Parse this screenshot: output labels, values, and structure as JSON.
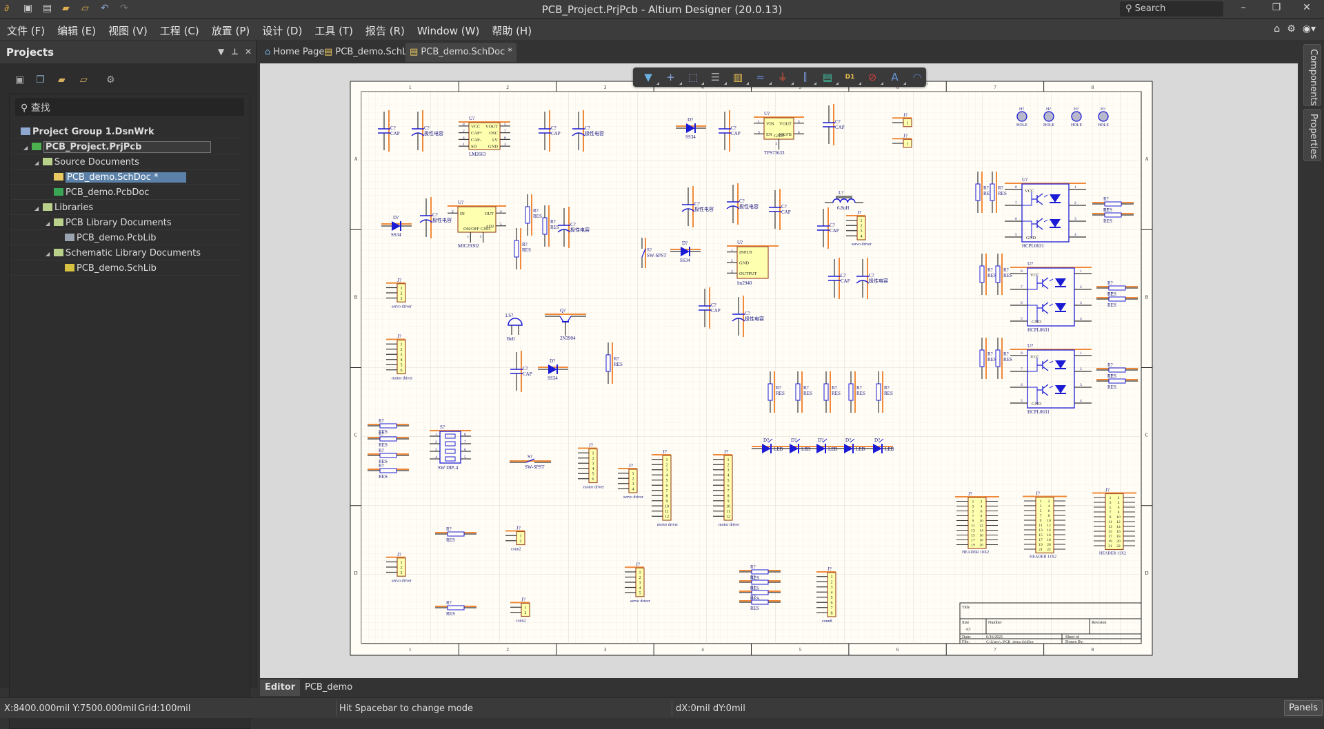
{
  "titlebar": {
    "title": "PCB_Project.PrjPcb - Altium Designer (20.0.13)",
    "search_placeholder": "Search"
  },
  "menu": [
    "文件 (F)",
    "编辑 (E)",
    "视图 (V)",
    "工程 (C)",
    "放置 (P)",
    "设计 (D)",
    "工具 (T)",
    "报告 (R)",
    "Window (W)",
    "帮助 (H)"
  ],
  "projects_panel": {
    "title": "Projects",
    "search_placeholder": "查找",
    "tree": [
      {
        "label": "Project Group 1.DsnWrk",
        "bold": true,
        "icon": "workspace-icon"
      },
      {
        "label": "PCB_Project.PrjPcb",
        "bold": true,
        "icon": "pcb-project-icon",
        "selected_outline": true
      },
      {
        "label": "Source Documents",
        "icon": "folder-icon"
      },
      {
        "label": "PCB_demo.SchDoc *",
        "icon": "schdoc-icon",
        "selected": true
      },
      {
        "label": "PCB_demo.PcbDoc",
        "icon": "pcbdoc-icon"
      },
      {
        "label": "Libraries",
        "icon": "folder-icon"
      },
      {
        "label": "PCB Library Documents",
        "icon": "folder-icon"
      },
      {
        "label": "PCB_demo.PcbLib",
        "icon": "pcblib-icon"
      },
      {
        "label": "Schematic Library Documents",
        "icon": "folder-icon"
      },
      {
        "label": "PCB_demo.SchLib",
        "icon": "schlib-icon"
      }
    ]
  },
  "doc_tabs": [
    {
      "label": "Home Page",
      "icon": "home-icon"
    },
    {
      "label": "PCB_demo.SchLib",
      "icon": "schlib-icon"
    },
    {
      "label": "PCB_demo.SchDoc *",
      "icon": "schdoc-icon",
      "active": true
    }
  ],
  "schematic_toolbar": [
    "filter",
    "place-wire",
    "select-area",
    "align",
    "place-part",
    "place-bus",
    "place-ground",
    "place-port",
    "place-sheet-symbol",
    "place-net-label",
    "no-erc",
    "place-text",
    "place-arc"
  ],
  "sheet": {
    "columns": [
      "1",
      "2",
      "3",
      "4",
      "5",
      "6",
      "7",
      "8"
    ],
    "rows": [
      "A",
      "B",
      "C",
      "D"
    ],
    "title_block": {
      "title_label": "Title",
      "size_label": "Size",
      "size": "A3",
      "number_label": "Number",
      "revision_label": "Revision",
      "date_label": "Date:",
      "date": "6/16/2021",
      "sheet_label": "Sheet   of",
      "file_label": "File:",
      "file": "C:\\Users\\..\\PCB_demo.SchDoc",
      "drawn_by_label": "Drawn By:"
    }
  },
  "components": [
    {
      "type": "cap",
      "des": "C?",
      "value": "CAP"
    },
    {
      "type": "pcap",
      "des": "C?",
      "value": "极性电容"
    },
    {
      "type": "ic",
      "des": "U?",
      "value": "LM2663",
      "left": [
        "VCC",
        "CAP+",
        "CAP-",
        "SD"
      ],
      "right": [
        "VOUT",
        "OSC",
        "LV",
        "GND"
      ],
      "lpins": [
        "8",
        "2",
        "4",
        "1"
      ],
      "rpins": [
        "5",
        "7",
        "6",
        "3"
      ]
    },
    {
      "type": "cap",
      "des": "C?",
      "value": "CAP"
    },
    {
      "type": "pcap",
      "des": "C?",
      "value": "极性电容"
    },
    {
      "type": "diode",
      "des": "D?",
      "value": "SS34"
    },
    {
      "type": "cap",
      "des": "C?",
      "value": "CAP"
    },
    {
      "type": "ic",
      "des": "U?",
      "value": "TPS73633",
      "left": [
        "VIN",
        "EN"
      ],
      "right": [
        "VOUT",
        "NR/FB"
      ],
      "lpins": [
        "1",
        "3"
      ],
      "rpins": [
        "5",
        "4"
      ],
      "bottom": "GND",
      "bpins": [
        "2"
      ]
    },
    {
      "type": "cap",
      "des": "C?",
      "value": "CAP"
    },
    {
      "type": "header",
      "des": "J?",
      "value": "",
      "pins": [
        "1"
      ]
    },
    {
      "type": "header",
      "des": "J?",
      "value": "",
      "pins": [
        "1"
      ]
    },
    {
      "type": "hole",
      "des": "H?",
      "value": "HOLE"
    },
    {
      "type": "hole",
      "des": "H?",
      "value": "HOLE"
    },
    {
      "type": "hole",
      "des": "H?",
      "value": "HOLE"
    },
    {
      "type": "hole",
      "des": "H?",
      "value": "HOLE"
    },
    {
      "type": "diode",
      "des": "D?",
      "value": "SS34"
    },
    {
      "type": "pcap",
      "des": "C?",
      "value": "极性电容"
    },
    {
      "type": "ic",
      "des": "U?",
      "value": "MIC29302",
      "left": [
        "IN"
      ],
      "right": [
        "OUT",
        "ADJ"
      ],
      "lpins": [
        "2"
      ],
      "rpins": [
        "4",
        "5"
      ],
      "bottom": "ON/OFF GND",
      "bpins": [
        "1",
        "3"
      ]
    },
    {
      "type": "res",
      "des": "R?",
      "value": "RES"
    },
    {
      "type": "res",
      "des": "R?",
      "value": "RES"
    },
    {
      "type": "res",
      "des": "R?",
      "value": "RES"
    },
    {
      "type": "pcap",
      "des": "C?",
      "value": "极性电容"
    },
    {
      "type": "pcap",
      "des": "C?",
      "value": "极性电容"
    },
    {
      "type": "pcap",
      "des": "C?",
      "value": "极性电容"
    },
    {
      "type": "cap",
      "des": "C?",
      "value": "CAP"
    },
    {
      "type": "inductor",
      "des": "L?",
      "value": "6.8uH"
    },
    {
      "type": "cap",
      "des": "C?",
      "value": "CAP"
    },
    {
      "type": "header",
      "des": "J?",
      "value": "servo driver",
      "pins": [
        "1",
        "2",
        "3",
        "4"
      ]
    },
    {
      "type": "switch",
      "des": "S?",
      "value": "SW-SPST"
    },
    {
      "type": "diode",
      "des": "D?",
      "value": "SS34"
    },
    {
      "type": "ic",
      "des": "U?",
      "value": "lm2940",
      "left": [
        "INPUT",
        "GND",
        "OUTPUT"
      ],
      "right": [],
      "lpins": [
        "1",
        "2",
        "3"
      ],
      "rpins": []
    },
    {
      "type": "cap",
      "des": "C?",
      "value": "CAP"
    },
    {
      "type": "pcap",
      "des": "C?",
      "value": "极性电容"
    },
    {
      "type": "res",
      "des": "R?",
      "value": "RES"
    },
    {
      "type": "res",
      "des": "R?",
      "value": "RES"
    },
    {
      "type": "opto",
      "des": "U?",
      "value": "HCPL0631",
      "vcc": "VCC",
      "gnd": "GND",
      "lpins": [
        "8",
        "7",
        "6",
        "5"
      ],
      "rpins": [
        "1",
        "2",
        "3",
        "4"
      ]
    },
    {
      "type": "resh",
      "des": "R?",
      "value": "RES"
    },
    {
      "type": "resh",
      "des": "R?",
      "value": "RES"
    },
    {
      "type": "res",
      "des": "R?",
      "value": "RES"
    },
    {
      "type": "res",
      "des": "R?",
      "value": "RES"
    },
    {
      "type": "opto",
      "des": "U?",
      "value": "HCPL0631",
      "vcc": "VCC",
      "gnd": "GND",
      "lpins": [
        "8",
        "7",
        "6",
        "5"
      ],
      "rpins": [
        "1",
        "2",
        "3",
        "4"
      ]
    },
    {
      "type": "resh",
      "des": "R?",
      "value": "RES"
    },
    {
      "type": "resh",
      "des": "R?",
      "value": "RES"
    },
    {
      "type": "res",
      "des": "R?",
      "value": "RES"
    },
    {
      "type": "res",
      "des": "R?",
      "value": "RES"
    },
    {
      "type": "opto",
      "des": "U?",
      "value": "HCPL0631",
      "vcc": "VCC",
      "gnd": "GND",
      "lpins": [
        "8",
        "7",
        "6",
        "5"
      ],
      "rpins": [
        "1",
        "2",
        "3",
        "4"
      ]
    },
    {
      "type": "resh",
      "des": "R?",
      "value": "RES"
    },
    {
      "type": "resh",
      "des": "R?",
      "value": "RES"
    },
    {
      "type": "header",
      "des": "J?",
      "value": "servo driver",
      "pins": [
        "1",
        "2",
        "3"
      ]
    },
    {
      "type": "bell",
      "des": "LS?",
      "value": "Bell"
    },
    {
      "type": "transistor",
      "des": "Q?",
      "value": "2N3904"
    },
    {
      "type": "cap",
      "des": "C?",
      "value": "CAP"
    },
    {
      "type": "pcap",
      "des": "C?",
      "value": "极性电容"
    },
    {
      "type": "header",
      "des": "J?",
      "value": "motor driver",
      "pins": [
        "1",
        "2",
        "3",
        "4",
        "5",
        "6"
      ]
    },
    {
      "type": "cap",
      "des": "C?",
      "value": "CAP"
    },
    {
      "type": "diode",
      "des": "D?",
      "value": "SS34"
    },
    {
      "type": "res",
      "des": "R?",
      "value": "RES"
    },
    {
      "type": "res",
      "des": "R?",
      "value": "RES"
    },
    {
      "type": "res",
      "des": "R?",
      "value": "RES"
    },
    {
      "type": "res",
      "des": "R?",
      "value": "RES"
    },
    {
      "type": "res",
      "des": "R?",
      "value": "RES"
    },
    {
      "type": "res",
      "des": "R?",
      "value": "RES"
    },
    {
      "type": "led",
      "des": "D?",
      "value": "LED"
    },
    {
      "type": "led",
      "des": "D?",
      "value": "LED"
    },
    {
      "type": "led",
      "des": "D?",
      "value": "LED"
    },
    {
      "type": "led",
      "des": "D?",
      "value": "LED"
    },
    {
      "type": "led",
      "des": "D?",
      "value": "LED"
    },
    {
      "type": "resh",
      "des": "R?",
      "value": "RES"
    },
    {
      "type": "resh",
      "des": "R?",
      "value": "RES"
    },
    {
      "type": "resh",
      "des": "R?",
      "value": "RES"
    },
    {
      "type": "resh",
      "des": "R?",
      "value": "RES"
    },
    {
      "type": "dip",
      "des": "S?",
      "value": "SW DIP-4",
      "lpins": [
        "1",
        "2",
        "3",
        "4"
      ],
      "rpins": [
        "8",
        "7",
        "6",
        "5"
      ]
    },
    {
      "type": "switchh",
      "des": "S?",
      "value": "SW-SPST"
    },
    {
      "type": "header",
      "des": "J?",
      "value": "motor driver",
      "pins": [
        "1",
        "2",
        "3",
        "4",
        "5",
        "6"
      ]
    },
    {
      "type": "header",
      "des": "J?",
      "value": "servo driver",
      "pins": [
        "1",
        "2",
        "3",
        "4"
      ]
    },
    {
      "type": "header",
      "des": "J?",
      "value": "motor driver",
      "pins": [
        "1",
        "2",
        "3",
        "4",
        "5",
        "6",
        "7",
        "8",
        "9",
        "10",
        "11",
        "12"
      ]
    },
    {
      "type": "header",
      "des": "J?",
      "value": "motor driver",
      "pins": [
        "1",
        "2",
        "3",
        "4",
        "5",
        "6",
        "7",
        "8",
        "9",
        "10",
        "11",
        "12"
      ]
    },
    {
      "type": "header2",
      "des": "J?",
      "value": "HEADER 10X2",
      "pins": [
        "1",
        "2",
        "3",
        "4",
        "5",
        "6",
        "7",
        "8",
        "9",
        "10",
        "11",
        "12",
        "13",
        "14",
        "15",
        "16",
        "17",
        "18",
        "19",
        "20"
      ]
    },
    {
      "type": "header2",
      "des": "J?",
      "value": "HEADER 11X2",
      "pins": [
        "1",
        "2",
        "3",
        "4",
        "5",
        "6",
        "7",
        "8",
        "9",
        "10",
        "11",
        "12",
        "13",
        "14",
        "15",
        "16",
        "17",
        "18",
        "19",
        "20",
        "21",
        "22"
      ]
    },
    {
      "type": "header2",
      "des": "J?",
      "value": "HEADER 11X2",
      "pins": [
        "1",
        "2",
        "3",
        "4",
        "5",
        "6",
        "7",
        "8",
        "9",
        "10",
        "11",
        "12",
        "13",
        "14",
        "15",
        "16",
        "17",
        "18",
        "19",
        "20",
        "21",
        "22"
      ]
    },
    {
      "type": "resh",
      "des": "R?",
      "value": "RES"
    },
    {
      "type": "header",
      "des": "J?",
      "value": "conn2",
      "pins": [
        "1",
        "2"
      ]
    },
    {
      "type": "header",
      "des": "J?",
      "value": "servo driver",
      "pins": [
        "1",
        "2",
        "3"
      ]
    },
    {
      "type": "header",
      "des": "J?",
      "value": "servo driver",
      "pins": [
        "1",
        "2",
        "3",
        "4",
        "5"
      ]
    },
    {
      "type": "resh",
      "des": "R?",
      "value": "RES"
    },
    {
      "type": "resh",
      "des": "R?",
      "value": "RES"
    },
    {
      "type": "resh",
      "des": "R?",
      "value": "RES"
    },
    {
      "type": "resh",
      "des": "R?",
      "value": "RES"
    },
    {
      "type": "header",
      "des": "J?",
      "value": "conn8",
      "pins": [
        "1",
        "2",
        "3",
        "4",
        "5",
        "6",
        "7",
        "8"
      ]
    },
    {
      "type": "resh",
      "des": "R?",
      "value": "RES"
    },
    {
      "type": "header",
      "des": "J?",
      "value": "conn2",
      "pins": [
        "1",
        "2"
      ]
    }
  ],
  "bottom_tabs": [
    {
      "label": "Editor",
      "active": true
    },
    {
      "label": "PCB_demo"
    }
  ],
  "status": {
    "coords": "X:8400.000mil Y:7500.000mil",
    "grid": "Grid:100mil",
    "hint": "Hit Spacebar to change mode",
    "delta": "dX:0mil dY:0mil",
    "panels_button": "Panels"
  },
  "right_panels": [
    "Components",
    "Properties"
  ],
  "colors": {
    "wire_highlight": "#f08a3a",
    "symbol_blue": "#1b1bd6",
    "part_fill": "#ffffb0",
    "selection": "#5b81a8"
  }
}
